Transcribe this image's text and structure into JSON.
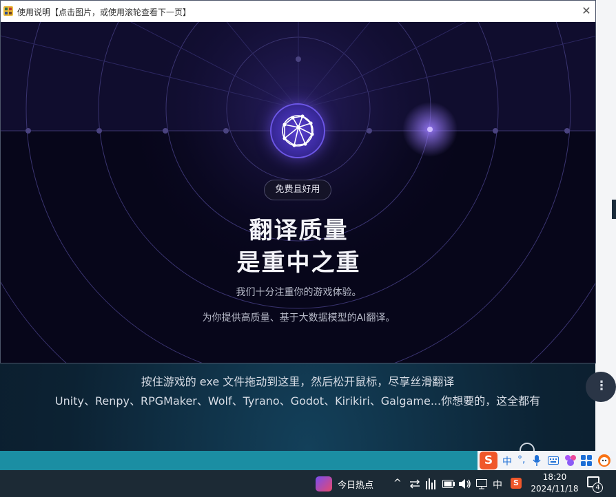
{
  "window": {
    "title": "使用说明【点击图片，或使用滚轮查看下一页】",
    "close_glyph": "✕",
    "app_icon": "app-icon"
  },
  "hero": {
    "badge": "免费且好用",
    "headline_line1": "翻译质量",
    "headline_line2": "是重中之重",
    "subtitle1": "我们十分注重你的游戏体验。",
    "subtitle2": "为你提供高质量、基于大数据模型的AI翻译。",
    "logo_icon": "network-globe-icon",
    "accent_color": "#5a3fd0"
  },
  "background_app": {
    "drop_hint": "按住游戏的 exe 文件拖动到这里，然后松开鼠标，尽享丝滑翻译",
    "engines": "Unity、Renpy、RPGMaker、Wolf、Tyrano、Godot、Kirikiri、Galgame...你想要的，这全都有",
    "menu_glyph": "⋮"
  },
  "ime": {
    "logo": "S",
    "mode": "中",
    "punct": "°,",
    "mic_icon": "microphone-icon",
    "keyboard_icon": "keyboard-icon"
  },
  "taskbar": {
    "news_label": "今日热点",
    "chevron": "^",
    "input_mode": "中",
    "sogou": "S",
    "time": "18:20",
    "date": "2024/11/18",
    "notification_count": "4"
  }
}
